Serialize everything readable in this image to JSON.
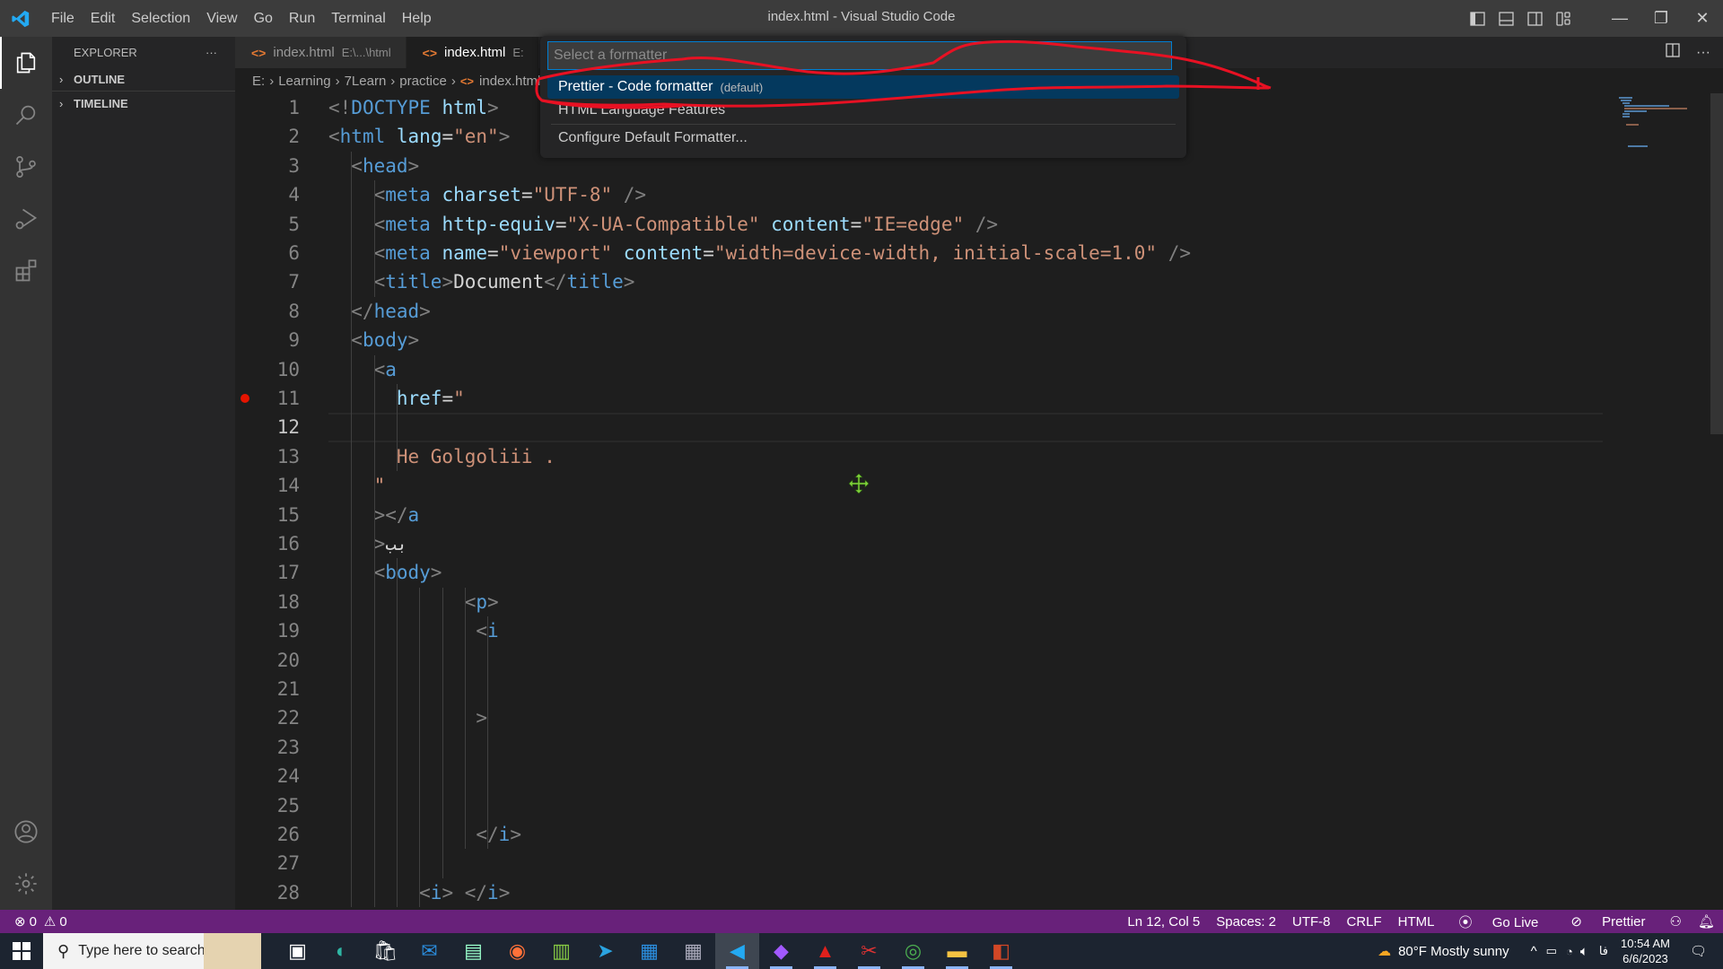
{
  "window": {
    "title": "index.html - Visual Studio Code",
    "menu": [
      "File",
      "Edit",
      "Selection",
      "View",
      "Go",
      "Run",
      "Terminal",
      "Help"
    ],
    "controls": {
      "minimize": "—",
      "restore": "❐",
      "close": "✕"
    }
  },
  "activity_bar": {
    "items": [
      "explorer-icon",
      "search-icon",
      "source-control-icon",
      "run-debug-icon",
      "extensions-icon"
    ],
    "bottom": [
      "accounts-icon",
      "manage-gear-icon"
    ]
  },
  "sidebar": {
    "title": "EXPLORER",
    "more": "···",
    "sections": [
      {
        "label": "OUTLINE",
        "expanded": false
      },
      {
        "label": "TIMELINE",
        "expanded": false
      }
    ]
  },
  "tabs": [
    {
      "label": "index.html",
      "hint": "E:\\...\\html",
      "active": false
    },
    {
      "label": "index.html",
      "hint": "E:",
      "active": true
    }
  ],
  "breadcrumb": [
    "E:",
    "Learning",
    "7Learn",
    "practice",
    "index.html"
  ],
  "quick_pick": {
    "placeholder": "Select a formatter",
    "value": "",
    "items": [
      {
        "label": "Prettier - Code formatter",
        "description": "(default)",
        "selected": true
      },
      {
        "label": "HTML Language Features",
        "description": "",
        "selected": false
      },
      {
        "label": "Configure Default Formatter...",
        "description": "",
        "selected": false
      }
    ]
  },
  "editor": {
    "current_line": 12,
    "breakpoint_line": 11,
    "lines": [
      [
        [
          "t-p",
          "<!"
        ],
        [
          "t-tag",
          "DOCTYPE"
        ],
        [
          "t-p",
          " "
        ],
        [
          "t-attr",
          "html"
        ],
        [
          "t-p",
          ">"
        ]
      ],
      [
        [
          "t-p",
          "<"
        ],
        [
          "t-tag",
          "html"
        ],
        [
          "t-p",
          " "
        ],
        [
          "t-attr",
          "lang"
        ],
        [
          "t-txt",
          "="
        ],
        [
          "t-str",
          "\"en\""
        ],
        [
          "t-p",
          ">"
        ]
      ],
      [
        [
          "t-p",
          "  <"
        ],
        [
          "t-tag",
          "head"
        ],
        [
          "t-p",
          ">"
        ]
      ],
      [
        [
          "t-p",
          "    <"
        ],
        [
          "t-tag",
          "meta"
        ],
        [
          "t-p",
          " "
        ],
        [
          "t-attr",
          "charset"
        ],
        [
          "t-txt",
          "="
        ],
        [
          "t-str",
          "\"UTF-8\""
        ],
        [
          "t-p",
          " />"
        ]
      ],
      [
        [
          "t-p",
          "    <"
        ],
        [
          "t-tag",
          "meta"
        ],
        [
          "t-p",
          " "
        ],
        [
          "t-attr",
          "http-equiv"
        ],
        [
          "t-txt",
          "="
        ],
        [
          "t-str",
          "\"X-UA-Compatible\""
        ],
        [
          "t-p",
          " "
        ],
        [
          "t-attr",
          "content"
        ],
        [
          "t-txt",
          "="
        ],
        [
          "t-str",
          "\"IE=edge\""
        ],
        [
          "t-p",
          " />"
        ]
      ],
      [
        [
          "t-p",
          "    <"
        ],
        [
          "t-tag",
          "meta"
        ],
        [
          "t-p",
          " "
        ],
        [
          "t-attr",
          "name"
        ],
        [
          "t-txt",
          "="
        ],
        [
          "t-str",
          "\"viewport\""
        ],
        [
          "t-p",
          " "
        ],
        [
          "t-attr",
          "content"
        ],
        [
          "t-txt",
          "="
        ],
        [
          "t-str",
          "\"width=device-width, initial-scale=1.0\""
        ],
        [
          "t-p",
          " />"
        ]
      ],
      [
        [
          "t-p",
          "    <"
        ],
        [
          "t-tag",
          "title"
        ],
        [
          "t-p",
          ">"
        ],
        [
          "t-txt",
          "Document"
        ],
        [
          "t-p",
          "</"
        ],
        [
          "t-tag",
          "title"
        ],
        [
          "t-p",
          ">"
        ]
      ],
      [
        [
          "t-p",
          "  </"
        ],
        [
          "t-tag",
          "head"
        ],
        [
          "t-p",
          ">"
        ]
      ],
      [
        [
          "t-p",
          "  <"
        ],
        [
          "t-tag",
          "body"
        ],
        [
          "t-p",
          ">"
        ]
      ],
      [
        [
          "t-p",
          "    <"
        ],
        [
          "t-tag",
          "a"
        ]
      ],
      [
        [
          "t-p",
          "      "
        ],
        [
          "t-attr",
          "href"
        ],
        [
          "t-txt",
          "="
        ],
        [
          "t-str",
          "\""
        ]
      ],
      [],
      [
        [
          "t-p",
          "      "
        ],
        [
          "t-str",
          "He Golgoliii ."
        ]
      ],
      [
        [
          "t-p",
          "    "
        ],
        [
          "t-str",
          "\""
        ]
      ],
      [
        [
          "t-p",
          "    ></"
        ],
        [
          "t-tag",
          "a"
        ]
      ],
      [
        [
          "t-p",
          "    >"
        ],
        [
          "t-txt",
          "بب"
        ]
      ],
      [
        [
          "t-p",
          "    <"
        ],
        [
          "t-tag",
          "body"
        ],
        [
          "t-p",
          ">"
        ]
      ],
      [
        [
          "t-p",
          "            <"
        ],
        [
          "t-tag",
          "p"
        ],
        [
          "t-p",
          ">"
        ]
      ],
      [
        [
          "t-p",
          "             <"
        ],
        [
          "t-tag",
          "i"
        ]
      ],
      [],
      [],
      [
        [
          "t-p",
          "             >"
        ]
      ],
      [],
      [],
      [],
      [
        [
          "t-p",
          "             </"
        ],
        [
          "t-tag",
          "i"
        ],
        [
          "t-p",
          ">"
        ]
      ],
      [],
      [
        [
          "t-p",
          "        <"
        ],
        [
          "t-tag",
          "i"
        ],
        [
          "t-p",
          "> </"
        ],
        [
          "t-tag",
          "i"
        ],
        [
          "t-p",
          ">"
        ]
      ]
    ]
  },
  "status_bar": {
    "errors": "0",
    "warnings": "0",
    "position": "Ln 12, Col 5",
    "spaces": "Spaces: 2",
    "encoding": "UTF-8",
    "eol": "CRLF",
    "language": "HTML",
    "go_live": "Go Live",
    "prettier": "Prettier"
  },
  "taskbar": {
    "search_placeholder": "Type here to search",
    "apps": [
      "task-view",
      "edge",
      "store",
      "mail",
      "notepad",
      "firefox",
      "notepad-plus",
      "telegram",
      "calendar",
      "calculator",
      "vscode",
      "figma",
      "acrobat",
      "snipping",
      "chrome",
      "file-explorer",
      "powerpoint"
    ],
    "active_app": "vscode",
    "weather": "80°F  Mostly sunny",
    "weather_badge": "1",
    "language": "فا",
    "time": "10:54 AM",
    "date": "6/6/2023"
  },
  "colors": {
    "accent": "#007fd4",
    "status_bar": "#68217a",
    "selection": "#04395e",
    "annotation_scribble": "#e81123"
  }
}
